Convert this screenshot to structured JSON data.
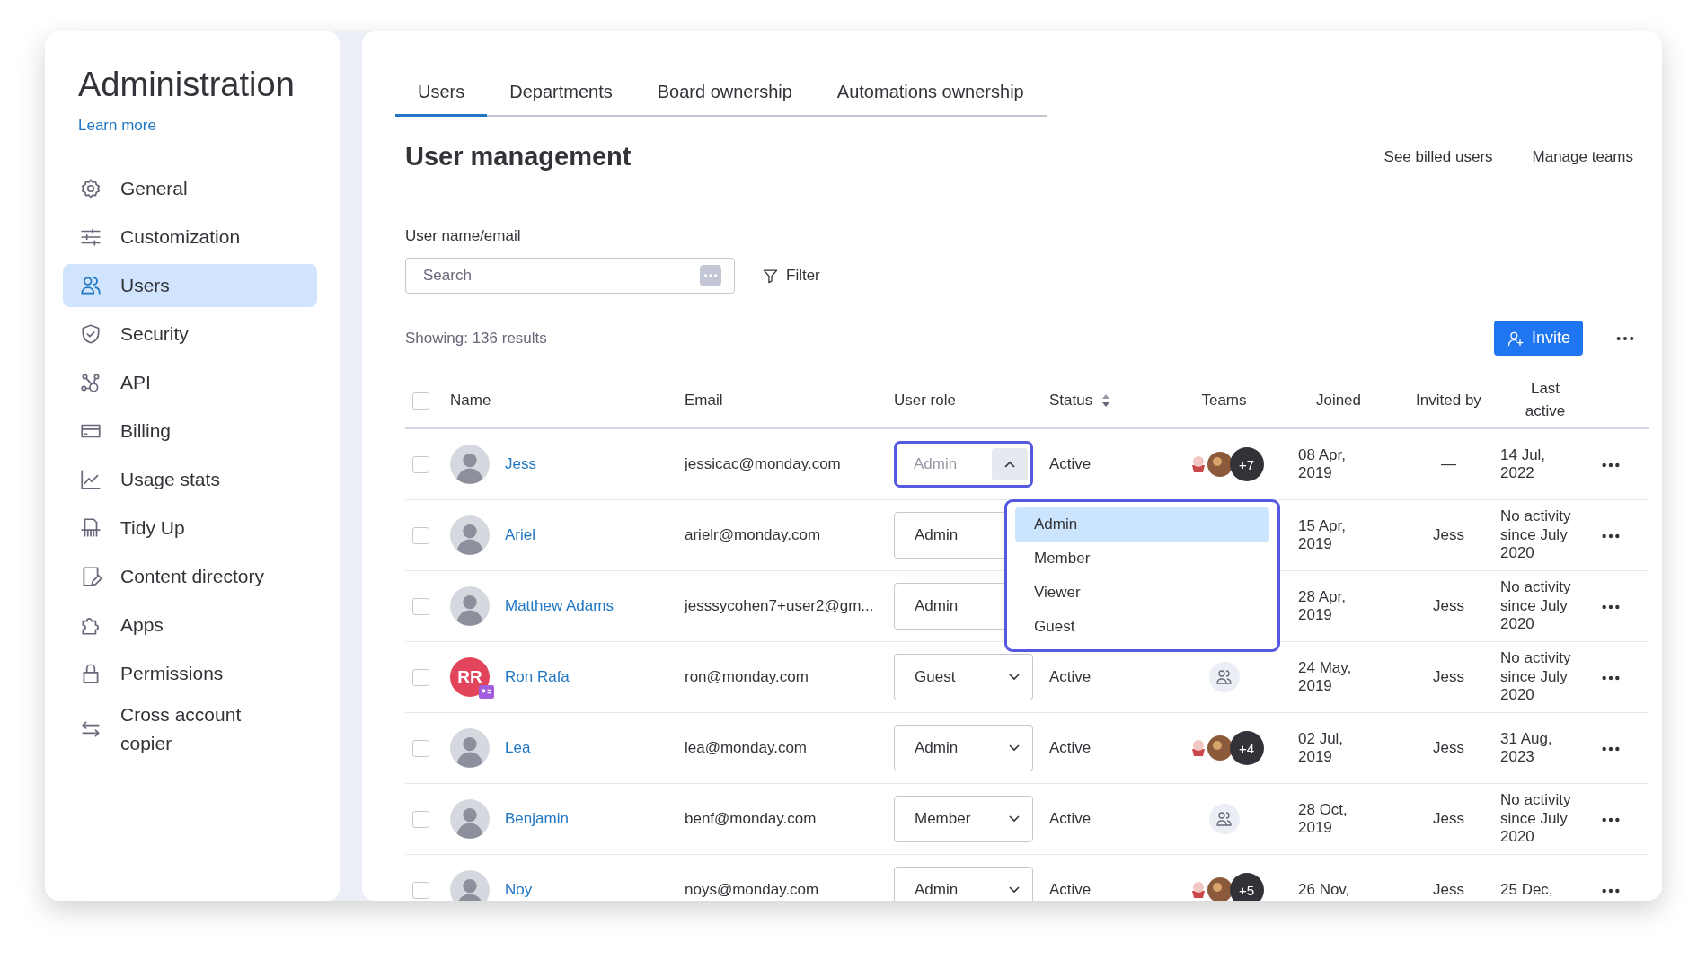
{
  "sidebar": {
    "title": "Administration",
    "link": "Learn more",
    "items": [
      {
        "label": "General",
        "selected": false
      },
      {
        "label": "Customization",
        "selected": false
      },
      {
        "label": "Users",
        "selected": true
      },
      {
        "label": "Security",
        "selected": false
      },
      {
        "label": "API",
        "selected": false
      },
      {
        "label": "Billing",
        "selected": false
      },
      {
        "label": "Usage stats",
        "selected": false
      },
      {
        "label": "Tidy Up",
        "selected": false
      },
      {
        "label": "Content directory",
        "selected": false
      },
      {
        "label": "Apps",
        "selected": false
      },
      {
        "label": "Permissions",
        "selected": false
      },
      {
        "label": "Cross account copier",
        "selected": false
      }
    ]
  },
  "tabs": [
    {
      "label": "Users",
      "selected": true
    },
    {
      "label": "Departments",
      "selected": false
    },
    {
      "label": "Board ownership",
      "selected": false
    },
    {
      "label": "Automations ownership",
      "selected": false
    }
  ],
  "header": {
    "title": "User management",
    "links": [
      "See billed users",
      "Manage teams"
    ]
  },
  "search": {
    "label": "User name/email",
    "placeholder": "Search"
  },
  "filter": "Filter",
  "results": "Showing: 136 results",
  "invite": "Invite",
  "table": {
    "all_checked": false,
    "columns": [
      "Name",
      "Email",
      "User role",
      "Status",
      "Teams",
      "Joined",
      "Invited by",
      "Last active"
    ],
    "rows": [
      {
        "checked": false,
        "avatar": {
          "kind": "photo"
        },
        "name": "Jess",
        "email": "jessicac@monday.com",
        "role": "Admin",
        "kind": "open",
        "status": "Active",
        "teams": {
          "kind": "avatars",
          "count": "+7"
        },
        "joined": "08 Apr, 2019",
        "invited_by": "—",
        "last_active": "14 Jul, 2022"
      },
      {
        "checked": false,
        "avatar": {
          "kind": "photo"
        },
        "name": "Ariel",
        "email": "arielr@monday.com",
        "role": "Admin",
        "kind": "covered",
        "joined": "15 Apr, 2019",
        "invited_by": "Jess",
        "last_active": "No activity since July 2020"
      },
      {
        "checked": false,
        "avatar": {
          "kind": "photo"
        },
        "name": "Matthew Adams",
        "email": "jesssycohen7+user2@gm...",
        "role": "Admin",
        "kind": "covered",
        "joined": "28 Apr, 2019",
        "invited_by": "Jess",
        "last_active": "No activity since July 2020"
      },
      {
        "checked": false,
        "avatar": {
          "kind": "initials",
          "initials": "RR"
        },
        "name": "Ron Rafa",
        "email": "ron@monday.com",
        "role": "Guest",
        "kind": "plain",
        "status": "Active",
        "teams": {
          "kind": "none"
        },
        "joined": "24 May, 2019",
        "invited_by": "Jess",
        "last_active": "No activity since July 2020"
      },
      {
        "checked": false,
        "avatar": {
          "kind": "photo"
        },
        "name": "Lea",
        "email": "lea@monday.com",
        "role": "Admin",
        "kind": "plain",
        "status": "Active",
        "teams": {
          "kind": "avatars",
          "count": "+4"
        },
        "joined": "02 Jul, 2019",
        "invited_by": "Jess",
        "last_active": "31 Aug, 2023"
      },
      {
        "checked": false,
        "avatar": {
          "kind": "photo"
        },
        "name": "Benjamin",
        "email": "benf@monday.com",
        "role": "Member",
        "kind": "plain",
        "status": "Active",
        "teams": {
          "kind": "none"
        },
        "joined": "28 Oct, 2019",
        "invited_by": "Jess",
        "last_active": "No activity since July 2020"
      },
      {
        "checked": false,
        "avatar": {
          "kind": "photo"
        },
        "name": "Noy",
        "email": "noys@monday.com",
        "role": "Admin",
        "kind": "plain",
        "status": "Active",
        "teams": {
          "kind": "avatars",
          "count": "+5"
        },
        "joined": "26 Nov,",
        "invited_by": "Jess",
        "last_active": "25 Dec,"
      }
    ]
  },
  "role_menu": {
    "options": [
      {
        "label": "Admin",
        "selected": true
      },
      {
        "label": "Member",
        "selected": false
      },
      {
        "label": "Viewer",
        "selected": false
      },
      {
        "label": "Guest",
        "selected": false
      }
    ]
  }
}
